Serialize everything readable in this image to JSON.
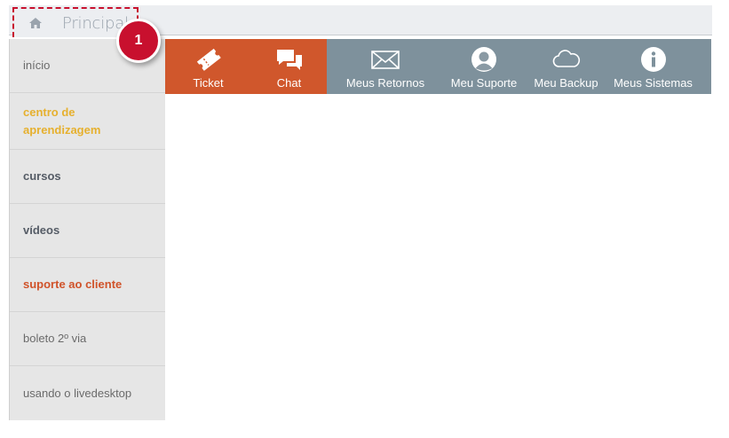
{
  "header": {
    "tab_label": "Principal"
  },
  "badge": {
    "number": "1"
  },
  "sidebar": {
    "items": [
      {
        "label": "início"
      },
      {
        "label": "centro de aprendizagem"
      },
      {
        "label": "cursos"
      },
      {
        "label": "vídeos"
      },
      {
        "label": "suporte ao cliente"
      },
      {
        "label": "boleto 2º via"
      },
      {
        "label": "usando o livedesktop"
      }
    ]
  },
  "toolbar": {
    "items": [
      {
        "label": "Ticket",
        "icon": "ticket-icon"
      },
      {
        "label": "Chat",
        "icon": "chat-icon"
      },
      {
        "label": "Meus Retornos",
        "icon": "envelope-icon"
      },
      {
        "label": "Meu Suporte",
        "icon": "user-icon"
      },
      {
        "label": "Meu Backup",
        "icon": "cloud-icon"
      },
      {
        "label": "Meus Sistemas",
        "icon": "info-icon"
      }
    ]
  },
  "colors": {
    "accent_orange": "#d0572c",
    "toolbar_gray": "#7e919c",
    "badge_red": "#c8102e",
    "gold": "#e6b02e"
  }
}
